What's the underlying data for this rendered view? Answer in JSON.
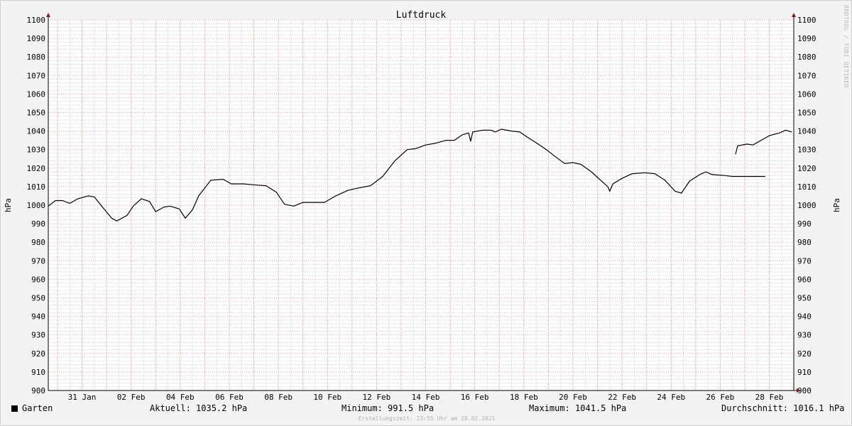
{
  "chart_data": {
    "type": "line",
    "title": "Luftdruck",
    "ylabel": "hPa",
    "ylabel_right": "hPa",
    "ylim": [
      900,
      1100
    ],
    "yticks": [
      900,
      910,
      920,
      930,
      940,
      950,
      960,
      970,
      980,
      990,
      1000,
      1010,
      1020,
      1030,
      1040,
      1050,
      1060,
      1070,
      1080,
      1090,
      1100
    ],
    "xlim": [
      "2021-01-29 15:00",
      "2021-02-28 23:55"
    ],
    "xticks": [
      {
        "date": "2021-01-31",
        "label": "31 Jan"
      },
      {
        "date": "2021-02-02",
        "label": "02 Feb"
      },
      {
        "date": "2021-02-04",
        "label": "04 Feb"
      },
      {
        "date": "2021-02-06",
        "label": "06 Feb"
      },
      {
        "date": "2021-02-08",
        "label": "08 Feb"
      },
      {
        "date": "2021-02-10",
        "label": "10 Feb"
      },
      {
        "date": "2021-02-12",
        "label": "12 Feb"
      },
      {
        "date": "2021-02-14",
        "label": "14 Feb"
      },
      {
        "date": "2021-02-16",
        "label": "16 Feb"
      },
      {
        "date": "2021-02-18",
        "label": "18 Feb"
      },
      {
        "date": "2021-02-20",
        "label": "20 Feb"
      },
      {
        "date": "2021-02-22",
        "label": "22 Feb"
      },
      {
        "date": "2021-02-24",
        "label": "24 Feb"
      },
      {
        "date": "2021-02-26",
        "label": "26 Feb"
      },
      {
        "date": "2021-02-28",
        "label": "28 Feb"
      }
    ],
    "grid": true,
    "series": [
      {
        "name": "Garten",
        "color": "#000000",
        "segments": [
          [
            [
              "2021-01-29 15:00",
              999.5
            ],
            [
              "2021-01-29 22:00",
              1002.5
            ],
            [
              "2021-01-30 05:00",
              1002.5
            ],
            [
              "2021-01-30 12:00",
              1001.0
            ],
            [
              "2021-01-30 20:00",
              1003.5
            ],
            [
              "2021-01-31 06:00",
              1005.0
            ],
            [
              "2021-01-31 12:00",
              1004.5
            ],
            [
              "2021-01-31 20:00",
              999.0
            ],
            [
              "2021-02-01 05:00",
              993.0
            ],
            [
              "2021-02-01 10:00",
              991.5
            ],
            [
              "2021-02-01 20:00",
              994.5
            ],
            [
              "2021-02-02 02:00",
              999.5
            ],
            [
              "2021-02-02 10:00",
              1003.5
            ],
            [
              "2021-02-02 18:00",
              1002.0
            ],
            [
              "2021-02-03 00:00",
              996.5
            ],
            [
              "2021-02-03 08:00",
              999.0
            ],
            [
              "2021-02-03 14:00",
              999.5
            ],
            [
              "2021-02-03 23:00",
              998.0
            ],
            [
              "2021-02-04 05:00",
              993.0
            ],
            [
              "2021-02-04 12:00",
              997.5
            ],
            [
              "2021-02-04 18:00",
              1005.0
            ],
            [
              "2021-02-05 06:00",
              1013.5
            ],
            [
              "2021-02-05 18:00",
              1014.0
            ],
            [
              "2021-02-06 02:00",
              1011.5
            ],
            [
              "2021-02-06 14:00",
              1011.5
            ],
            [
              "2021-02-07 00:00",
              1011.0
            ],
            [
              "2021-02-07 12:00",
              1010.5
            ],
            [
              "2021-02-07 22:00",
              1007.0
            ],
            [
              "2021-02-08 06:00",
              1000.5
            ],
            [
              "2021-02-08 15:00",
              999.5
            ],
            [
              "2021-02-09 00:00",
              1001.5
            ],
            [
              "2021-02-09 12:00",
              1001.5
            ],
            [
              "2021-02-09 21:00",
              1001.5
            ],
            [
              "2021-02-10 08:00",
              1005.0
            ],
            [
              "2021-02-10 20:00",
              1008.0
            ],
            [
              "2021-02-11 08:00",
              1009.5
            ],
            [
              "2021-02-11 18:00",
              1010.5
            ],
            [
              "2021-02-12 06:00",
              1015.5
            ],
            [
              "2021-02-12 18:00",
              1024.0
            ],
            [
              "2021-02-13 06:00",
              1030.0
            ],
            [
              "2021-02-13 14:00",
              1030.5
            ],
            [
              "2021-02-14 00:00",
              1032.5
            ],
            [
              "2021-02-14 10:00",
              1033.5
            ],
            [
              "2021-02-14 20:00",
              1035.0
            ],
            [
              "2021-02-15 04:00",
              1035.0
            ],
            [
              "2021-02-15 12:00",
              1038.0
            ],
            [
              "2021-02-15 18:00",
              1039.0
            ],
            [
              "2021-02-15 20:00",
              1034.5
            ],
            [
              "2021-02-15 22:00",
              1039.5
            ],
            [
              "2021-02-16 08:00",
              1040.5
            ],
            [
              "2021-02-16 16:00",
              1040.5
            ],
            [
              "2021-02-16 20:00",
              1039.5
            ],
            [
              "2021-02-17 02:00",
              1041.0
            ],
            [
              "2021-02-17 12:00",
              1040.0
            ],
            [
              "2021-02-17 20:00",
              1039.5
            ],
            [
              "2021-02-18 04:00",
              1036.5
            ],
            [
              "2021-02-18 14:00",
              1033.0
            ],
            [
              "2021-02-18 22:00",
              1030.0
            ],
            [
              "2021-02-19 06:00",
              1026.5
            ],
            [
              "2021-02-19 16:00",
              1022.5
            ],
            [
              "2021-02-20 00:00",
              1023.0
            ],
            [
              "2021-02-20 08:00",
              1022.0
            ],
            [
              "2021-02-20 18:00",
              1018.0
            ],
            [
              "2021-02-21 04:00",
              1013.0
            ],
            [
              "2021-02-21 10:00",
              1010.0
            ],
            [
              "2021-02-21 12:00",
              1007.5
            ],
            [
              "2021-02-21 15:00",
              1011.5
            ],
            [
              "2021-02-22 00:00",
              1014.5
            ],
            [
              "2021-02-22 10:00",
              1017.0
            ],
            [
              "2021-02-22 22:00",
              1017.5
            ],
            [
              "2021-02-23 08:00",
              1017.0
            ],
            [
              "2021-02-23 18:00",
              1013.5
            ],
            [
              "2021-02-24 04:00",
              1007.5
            ],
            [
              "2021-02-24 10:00",
              1006.5
            ],
            [
              "2021-02-24 18:00",
              1013.0
            ],
            [
              "2021-02-25 04:00",
              1016.5
            ],
            [
              "2021-02-25 10:00",
              1018.0
            ],
            [
              "2021-02-25 16:00",
              1016.5
            ],
            [
              "2021-02-26 04:00",
              1016.0
            ],
            [
              "2021-02-26 12:00",
              1015.5
            ],
            [
              "2021-02-27 04:00",
              1015.5
            ],
            [
              "2021-02-27 20:00",
              1015.5
            ]
          ],
          [
            [
              "2021-02-26 15:00",
              1027.5
            ],
            [
              "2021-02-26 17:00",
              1032.0
            ],
            [
              "2021-02-27 02:00",
              1033.0
            ],
            [
              "2021-02-27 08:00",
              1032.5
            ],
            [
              "2021-02-27 16:00",
              1035.0
            ],
            [
              "2021-02-28 00:00",
              1037.5
            ],
            [
              "2021-02-28 10:00",
              1039.0
            ],
            [
              "2021-02-28 16:00",
              1040.5
            ],
            [
              "2021-02-28 22:00",
              1039.5
            ]
          ]
        ]
      }
    ]
  },
  "legend": {
    "series_name": "Garten",
    "current": "Aktuell: 1035.2 hPa",
    "minimum": "Minimum: 991.5 hPa",
    "maximum": "Maximum: 1041.5 hPa",
    "average": "Durchschnitt: 1016.1 hPa"
  },
  "footer": "Erstellungszeit: 23:55 Uhr am 28.02.2021",
  "watermark": "RRDTOOL / TOBI OETIKER"
}
